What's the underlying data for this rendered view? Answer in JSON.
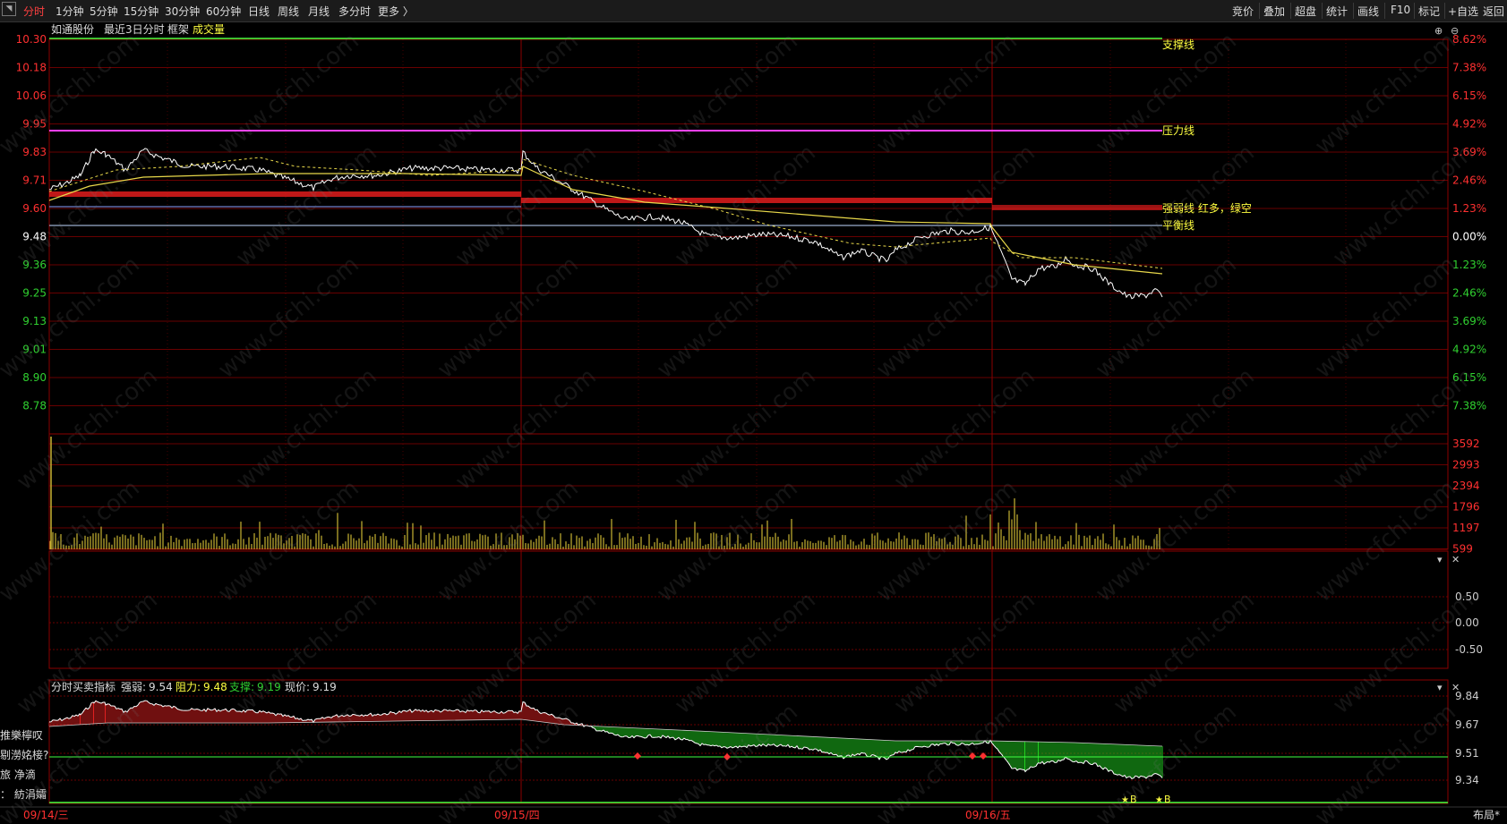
{
  "toolbar": {
    "periods": [
      "分时",
      "1分钟",
      "5分钟",
      "15分钟",
      "30分钟",
      "60分钟",
      "日线",
      "周线",
      "月线",
      "多分时",
      "更多 〉"
    ],
    "active_period": "分时",
    "right_buttons": [
      "竞价",
      "叠加",
      "超盘",
      "统计",
      "画线",
      "F10",
      "标记",
      "+自选",
      "返回"
    ]
  },
  "main_chart": {
    "stock_name": "如通股份",
    "period_label": "最近3日分时",
    "frame_label": "框架",
    "volume_label": "成交量",
    "price_labels": [
      "10.30",
      "10.18",
      "10.06",
      "9.95",
      "9.83",
      "9.71",
      "9.60",
      "9.48",
      "9.36",
      "9.25",
      "9.13",
      "9.01",
      "8.90",
      "8.78"
    ],
    "pct_labels": [
      "8.62%",
      "7.38%",
      "6.15%",
      "4.92%",
      "3.69%",
      "2.46%",
      "1.23%",
      "0.00%",
      "1.23%",
      "2.46%",
      "3.69%",
      "4.92%",
      "6.15%",
      "7.38%"
    ],
    "line_labels": {
      "support": "支撑线",
      "pressure": "压力线",
      "bull_bear": "强弱线 红多，绿空",
      "balance": "平衡线"
    },
    "prev_close": 9.48,
    "price_max": 10.3,
    "price_min": 8.7
  },
  "volume_chart": {
    "labels": [
      "3592",
      "2993",
      "2394",
      "1796",
      "1197",
      "599"
    ]
  },
  "indicator1": {
    "labels": [
      "0.50",
      "0.00",
      "-0.50"
    ]
  },
  "indicator2": {
    "title": "分时买卖指标",
    "strength_label": "强弱:",
    "strength_value": "9.54",
    "resistance_label": "阻力:",
    "resistance_value": "9.48",
    "support_label": "支撑:",
    "support_value": "9.19",
    "current_label": "现价:",
    "current_value": "9.19",
    "labels": [
      "9.84",
      "9.67",
      "9.51",
      "9.34"
    ],
    "left_truncated": [
      "推樂檸叹",
      "剔澇姳椄?",
      "旅  净滴",
      "：  紡涓孀"
    ],
    "marker_text": "B"
  },
  "dates": [
    "09/14/三",
    "09/15/四",
    "09/16/五"
  ],
  "bottom_right": "布局*",
  "watermark": "www.cfchi.com",
  "colors": {
    "up": "#ff3030",
    "down": "#30d030",
    "grid": "#8b0000",
    "price_line": "#ffffff",
    "avg_line": "#e8d84a",
    "pressure_line": "#ff40ff",
    "support_line": "#40ff40",
    "balance_line": "#c0d8ff",
    "label_yellow": "#ffff40"
  }
}
